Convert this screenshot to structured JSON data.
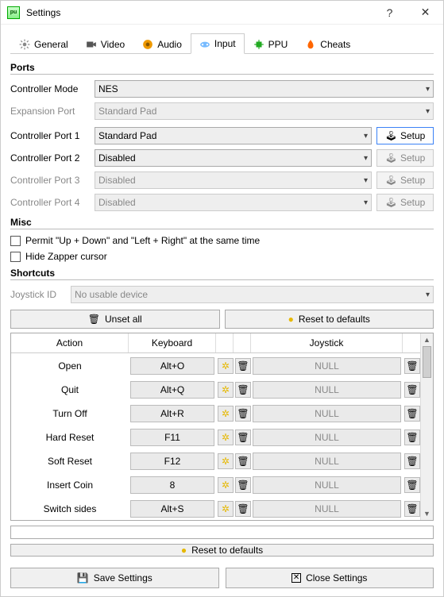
{
  "window": {
    "title": "Settings"
  },
  "tabs": {
    "general": "General",
    "video": "Video",
    "audio": "Audio",
    "input": "Input",
    "ppu": "PPU",
    "cheats": "Cheats"
  },
  "sections": {
    "ports": "Ports",
    "misc": "Misc",
    "shortcuts": "Shortcuts"
  },
  "ports": {
    "controller_mode_label": "Controller Mode",
    "controller_mode_value": "NES",
    "expansion_port_label": "Expansion Port",
    "expansion_port_value": "Standard Pad",
    "port1_label": "Controller Port 1",
    "port1_value": "Standard Pad",
    "port2_label": "Controller Port 2",
    "port2_value": "Disabled",
    "port3_label": "Controller Port 3",
    "port3_value": "Disabled",
    "port4_label": "Controller Port 4",
    "port4_value": "Disabled",
    "setup_label": "Setup"
  },
  "misc": {
    "permit_diag": "Permit \"Up + Down\" and \"Left + Right\" at the same time",
    "hide_zapper": "Hide Zapper cursor"
  },
  "shortcuts": {
    "joystick_id_label": "Joystick ID",
    "joystick_id_value": "No usable device",
    "unset_all": "Unset all",
    "reset_defaults": "Reset to defaults",
    "headers": {
      "action": "Action",
      "keyboard": "Keyboard",
      "joystick": "Joystick"
    },
    "rows": [
      {
        "action": "Open",
        "keyboard": "Alt+O",
        "joystick": "NULL"
      },
      {
        "action": "Quit",
        "keyboard": "Alt+Q",
        "joystick": "NULL"
      },
      {
        "action": "Turn Off",
        "keyboard": "Alt+R",
        "joystick": "NULL"
      },
      {
        "action": "Hard Reset",
        "keyboard": "F11",
        "joystick": "NULL"
      },
      {
        "action": "Soft Reset",
        "keyboard": "F12",
        "joystick": "NULL"
      },
      {
        "action": "Insert Coin",
        "keyboard": "8",
        "joystick": "NULL"
      },
      {
        "action": "Switch sides",
        "keyboard": "Alt+S",
        "joystick": "NULL"
      }
    ]
  },
  "lower_reset": "Reset to defaults",
  "footer": {
    "save": "Save Settings",
    "close": "Close Settings"
  }
}
